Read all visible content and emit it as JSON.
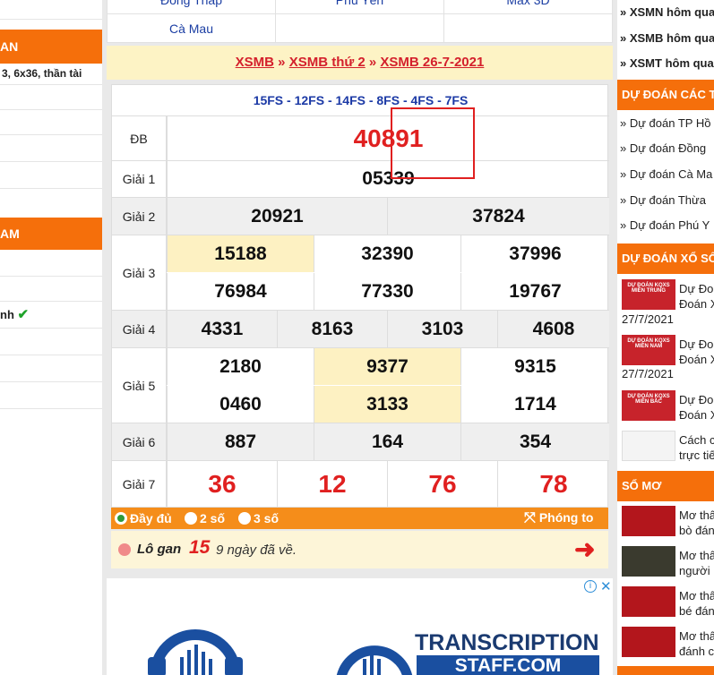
{
  "left": {
    "header1": "AN",
    "row1": "3, 6x36, thần tài",
    "header2": "AM",
    "row2": "nh"
  },
  "provinces": [
    "Đồng Tháp",
    "Phú Yên",
    "Max 3D",
    "Cà Mau"
  ],
  "breadcrumb": {
    "a": "XSMB",
    "sep": "»",
    "b": "XSMB thứ 2",
    "c": "XSMB 26-7-2021"
  },
  "codes": "15FS - 12FS - 14FS - 8FS - 4FS - 7FS",
  "results": {
    "db": {
      "label": "ĐB",
      "value": "40891"
    },
    "g1": {
      "label": "Giải 1",
      "values": [
        "05339"
      ]
    },
    "g2": {
      "label": "Giải 2",
      "values": [
        "20921",
        "37824"
      ]
    },
    "g3": {
      "label": "Giải 3",
      "values": [
        "15188",
        "32390",
        "37996",
        "76984",
        "77330",
        "19767"
      ]
    },
    "g4": {
      "label": "Giải 4",
      "values": [
        "4331",
        "8163",
        "3103",
        "4608"
      ]
    },
    "g5": {
      "label": "Giải 5",
      "values": [
        "2180",
        "9377",
        "9315",
        "0460",
        "3133",
        "1714"
      ]
    },
    "g6": {
      "label": "Giải 6",
      "values": [
        "887",
        "164",
        "354"
      ]
    },
    "g7": {
      "label": "Giải 7",
      "values": [
        "36",
        "12",
        "76",
        "78"
      ]
    }
  },
  "options": {
    "full": "Đầy đủ",
    "two": "2 số",
    "three": "3 số",
    "zoom": "Phóng to"
  },
  "logan": {
    "label": "Lô gan",
    "number": "15",
    "text": "9 ngày đã về."
  },
  "ad": {
    "brand1": "TRANSCRIPTION",
    "brand2": "STAFF.COM"
  },
  "right": {
    "links": [
      "XSMN hôm qua",
      "XSMB hôm qua",
      "XSMT hôm qua"
    ],
    "header1": "DỰ ĐOÁN CÁC TỈNH",
    "predict": [
      "Dự đoán TP Hồ",
      "Dự đoán Đồng",
      "Dự đoán Cà Ma",
      "Dự đoán Thừa",
      "Dự đoán Phú Y"
    ],
    "header2": "DỰ ĐOÁN XỔ SỐ",
    "news": [
      {
        "l1": "Dự Đo",
        "l2": "Đoán X",
        "date": "27/7/2021",
        "thumb": "DỰ ĐOÁN KQXS MIỀN TRUNG"
      },
      {
        "l1": "Dự Đo",
        "l2": "Đoán X",
        "date": "27/7/2021",
        "thumb": "DỰ ĐOÁN KQXS MIỀN NAM"
      },
      {
        "l1": "Dự Đo",
        "l2": "Đoán X",
        "date": "",
        "thumb": "DỰ ĐOÁN KQXS MIỀN BẮC"
      },
      {
        "l1": "Cách c",
        "l2": "trực tiế",
        "date": "",
        "thumb": ""
      }
    ],
    "header3": "SỔ MƠ",
    "somo": [
      {
        "l1": "Mơ thấ",
        "l2": "bò đánh"
      },
      {
        "l1": "Mơ thấ",
        "l2": "người"
      },
      {
        "l1": "Mơ thấ",
        "l2": "bé đánh"
      },
      {
        "l1": "Mơ thấ",
        "l2": "đánh c"
      }
    ]
  },
  "colors": {
    "orange": "#f56f0b",
    "red": "#e02020",
    "blue": "#1c3aa6",
    "yellow": "#fdf1c2"
  }
}
